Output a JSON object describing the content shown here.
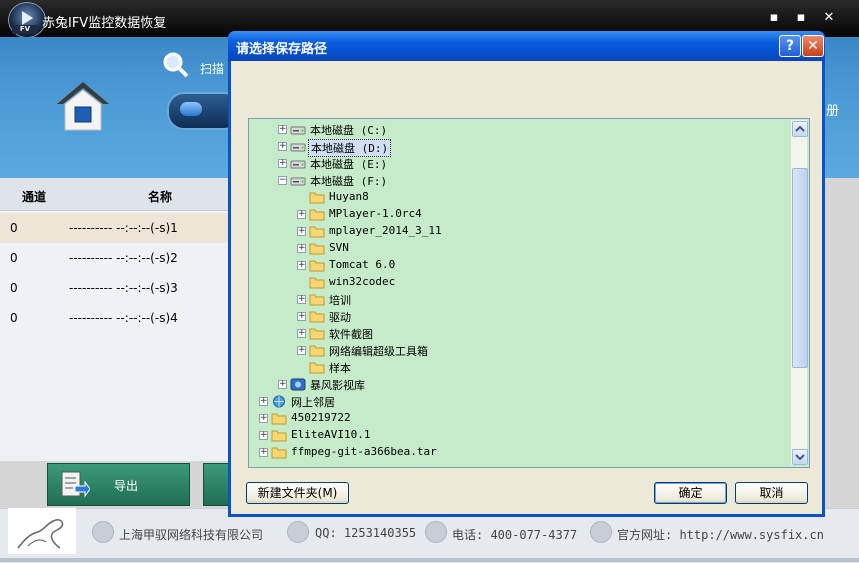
{
  "app": {
    "title": "赤兔IFV监控数据恢复",
    "logo_badge": "FV",
    "scan_label": "扫描",
    "register_label": "册",
    "window_controls": {
      "minimize": "▪",
      "maximize": "▪",
      "close": "✕"
    }
  },
  "table": {
    "headers": [
      "通道",
      "名称"
    ],
    "rows": [
      {
        "channel": "0",
        "name": "---------- --:--:--(-s)1",
        "selected": true
      },
      {
        "channel": "0",
        "name": "---------- --:--:--(-s)2"
      },
      {
        "channel": "0",
        "name": "---------- --:--:--(-s)3"
      },
      {
        "channel": "0",
        "name": "---------- --:--:--(-s)4"
      }
    ]
  },
  "export_label": "导出",
  "footer": {
    "company": "上海甲驭网络科技有限公司",
    "qq": "QQ: 1253140355",
    "phone": "电话: 400-077-4377",
    "website": "官方网址: http://www.sysfix.cn"
  },
  "dialog": {
    "title": "请选择保存路径",
    "help": "?",
    "close": "✕",
    "new_folder_label": "新建文件夹(M)",
    "ok_label": "确定",
    "cancel_label": "取消",
    "tree": [
      {
        "label": "本地磁盘 (C:)",
        "icon": "drive-icon",
        "expander": "+",
        "level": 1
      },
      {
        "label": "本地磁盘 (D:)",
        "icon": "drive-icon",
        "expander": "+",
        "level": 1,
        "selected": true
      },
      {
        "label": "本地磁盘 (E:)",
        "icon": "drive-icon",
        "expander": "+",
        "level": 1
      },
      {
        "label": "本地磁盘 (F:)",
        "icon": "drive-icon",
        "expander": "−",
        "level": 1
      },
      {
        "label": "Huyan8",
        "icon": "folder-icon",
        "expander": "",
        "level": 2
      },
      {
        "label": "MPlayer-1.0rc4",
        "icon": "folder-icon",
        "expander": "+",
        "level": 2
      },
      {
        "label": "mplayer_2014_3_11",
        "icon": "folder-icon",
        "expander": "+",
        "level": 2
      },
      {
        "label": "SVN",
        "icon": "folder-icon",
        "expander": "+",
        "level": 2
      },
      {
        "label": "Tomcat 6.0",
        "icon": "folder-icon",
        "expander": "+",
        "level": 2
      },
      {
        "label": "win32codec",
        "icon": "folder-icon",
        "expander": "",
        "level": 2
      },
      {
        "label": "培训",
        "icon": "folder-icon",
        "expander": "+",
        "level": 2
      },
      {
        "label": "驱动",
        "icon": "folder-icon",
        "expander": "+",
        "level": 2
      },
      {
        "label": "软件截图",
        "icon": "folder-icon",
        "expander": "+",
        "level": 2
      },
      {
        "label": "网络编辑超级工具箱",
        "icon": "folder-icon",
        "expander": "+",
        "level": 2
      },
      {
        "label": "样本",
        "icon": "folder-icon",
        "expander": "",
        "level": 2
      },
      {
        "label": "暴风影视库",
        "icon": "media-library-icon",
        "expander": "+",
        "level": 1
      },
      {
        "label": "网上邻居",
        "icon": "network-icon",
        "expander": "+",
        "level": 0
      },
      {
        "label": "450219722",
        "icon": "folder-icon",
        "expander": "+",
        "level": 0
      },
      {
        "label": "EliteAVI10.1",
        "icon": "folder-icon",
        "expander": "+",
        "level": 0
      },
      {
        "label": "ffmpeg-git-a366bea.tar",
        "icon": "folder-icon",
        "expander": "+",
        "level": 0
      }
    ]
  }
}
